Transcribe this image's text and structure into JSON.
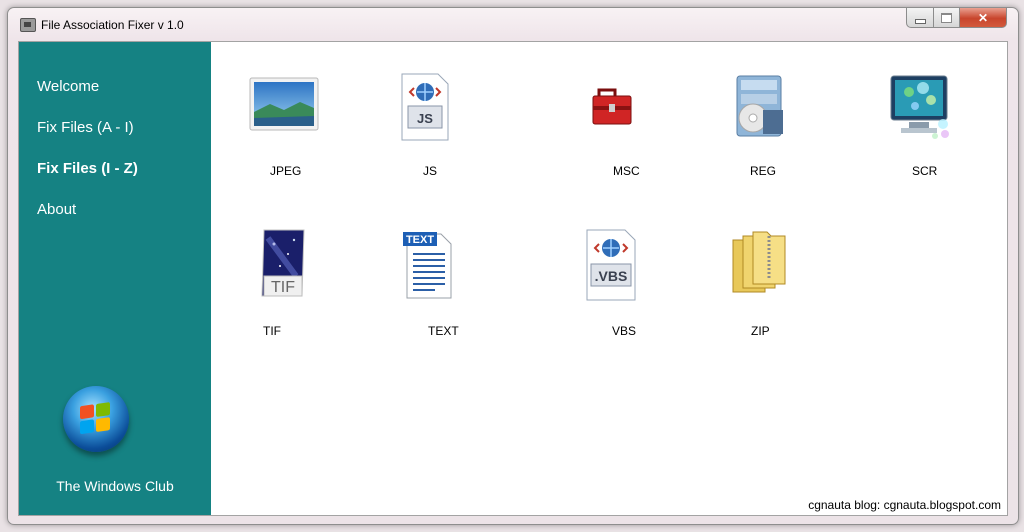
{
  "window": {
    "title": "File Association Fixer v 1.0"
  },
  "sidebar": {
    "items": [
      {
        "label": "Welcome"
      },
      {
        "label": "Fix Files (A - I)"
      },
      {
        "label": "Fix Files (I - Z)"
      },
      {
        "label": "About"
      }
    ],
    "active_index": 2,
    "brand": "The Windows Club",
    "color": "#158283"
  },
  "files": [
    {
      "label": "JPEG",
      "icon": "jpeg-file-icon"
    },
    {
      "label": "JS",
      "icon": "js-file-icon"
    },
    {
      "label": "MSC",
      "icon": "msc-toolbox-icon"
    },
    {
      "label": "REG",
      "icon": "registry-icon"
    },
    {
      "label": "SCR",
      "icon": "screensaver-icon"
    },
    {
      "label": "TIF",
      "icon": "tif-file-icon"
    },
    {
      "label": "TEXT",
      "icon": "text-file-icon"
    },
    {
      "label": "VBS",
      "icon": "vbs-file-icon"
    },
    {
      "label": "ZIP",
      "icon": "zip-folder-icon"
    }
  ],
  "footer": "cgnauta blog: cgnauta.blogspot.com"
}
